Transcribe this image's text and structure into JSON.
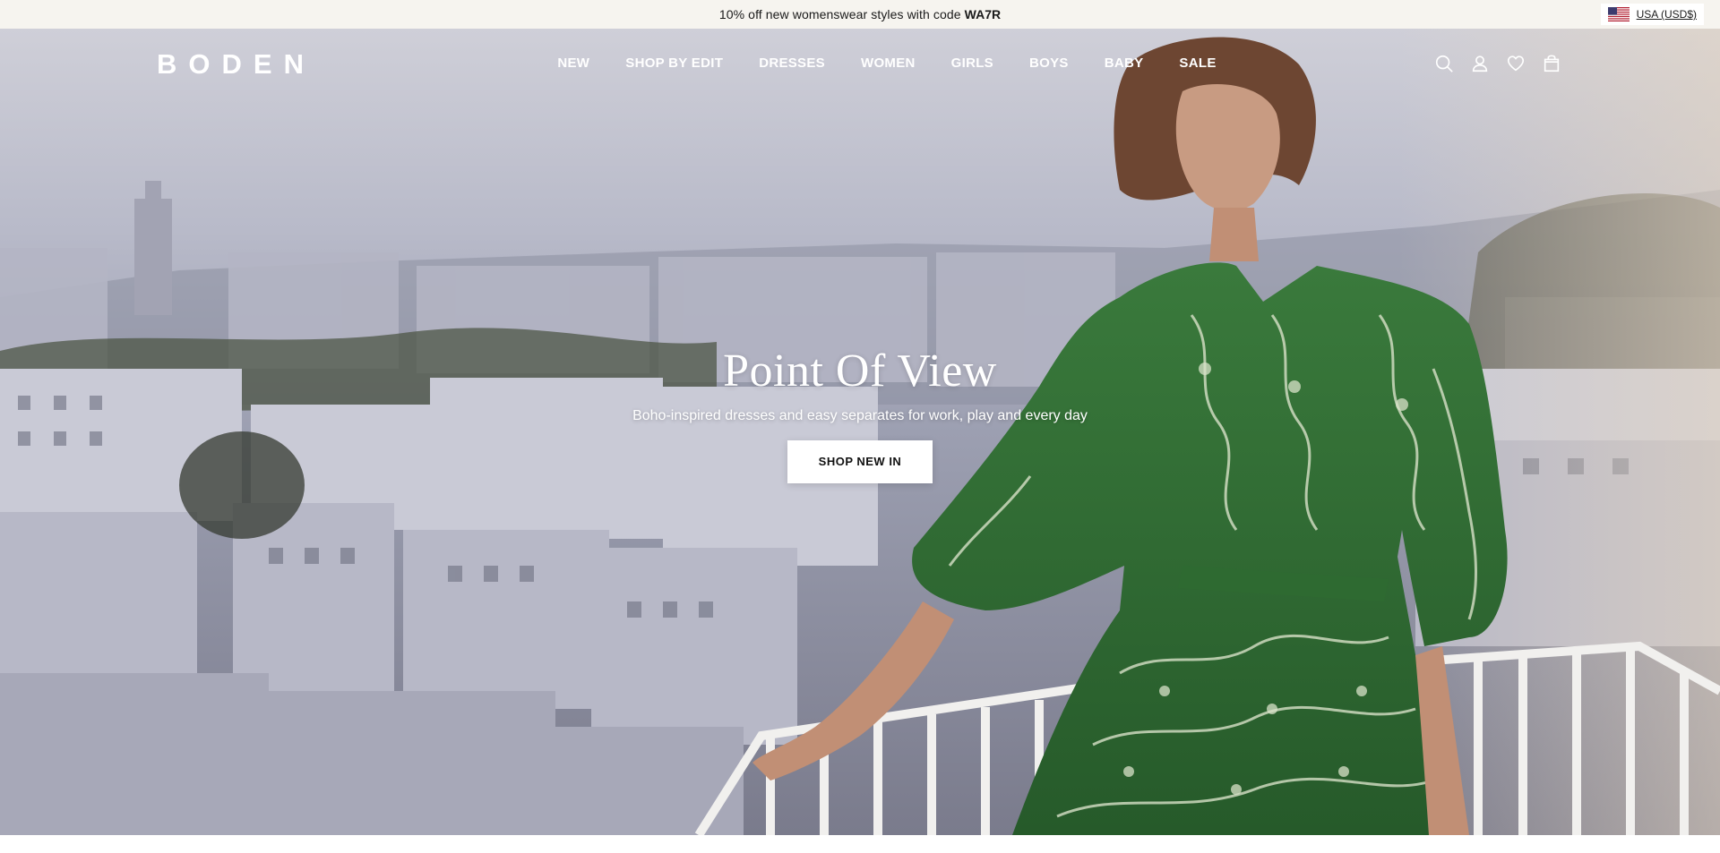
{
  "promo": {
    "text": "10% off new womenswear styles with code",
    "code": "WA7R"
  },
  "region": {
    "label": "USA (USD$)",
    "flag_icon": "us-flag-icon"
  },
  "header": {
    "logo": "BODEN",
    "nav": [
      {
        "label": "NEW"
      },
      {
        "label": "SHOP BY EDIT"
      },
      {
        "label": "DRESSES"
      },
      {
        "label": "WOMEN"
      },
      {
        "label": "GIRLS"
      },
      {
        "label": "BOYS"
      },
      {
        "label": "BABY"
      },
      {
        "label": "SALE"
      }
    ],
    "icons": [
      "search-icon",
      "account-icon",
      "wishlist-heart-icon",
      "shopping-bag-icon"
    ]
  },
  "hero": {
    "title": "Point Of View",
    "subtitle": "Boho-inspired dresses and easy separates for work, play and every day",
    "cta_label": "SHOP NEW IN"
  },
  "colors": {
    "promo_bg": "#f6f4ef",
    "dress_green": "#2f6b33",
    "cta_bg": "#ffffff",
    "nav_text": "#ffffff"
  }
}
